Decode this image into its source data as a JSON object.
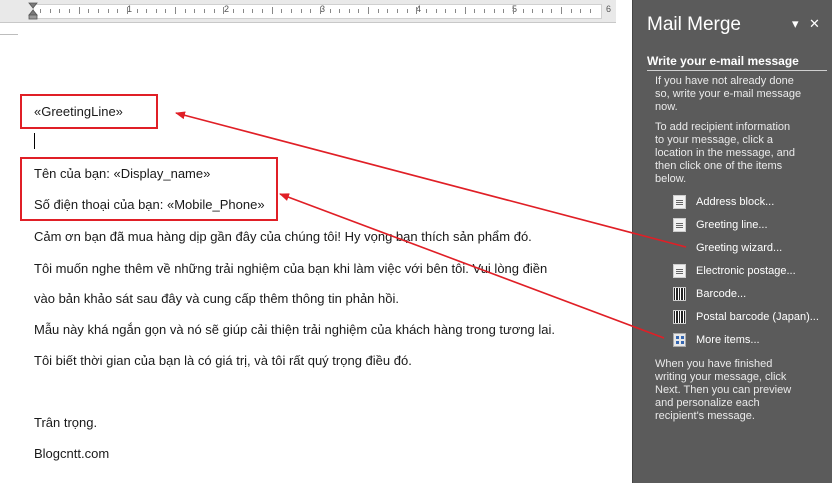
{
  "ruler": {
    "marks": [
      "1",
      "2",
      "3",
      "4",
      "5",
      "6"
    ]
  },
  "document": {
    "fields": {
      "greeting": "«GreetingLine»",
      "name_line": "Tên của bạn: «Display_name»",
      "phone_line": "Số điện thoại của bạn: «Mobile_Phone»"
    },
    "paragraphs": [
      "Cảm ơn bạn đã mua hàng dịp gần đây của chúng tôi! Hy vọng bạn thích sản phẩm đó.",
      "Tôi muốn nghe thêm về những trải nghiệm của bạn khi làm việc với bên tôi. Vui lòng điền",
      "vào bản khảo sát sau đây và cung cấp thêm thông tin phản hồi.",
      "Mẫu này khá ngắn gọn và nó sẽ giúp cải thiện trải nghiệm của khách hàng trong tương lai.",
      "Tôi biết thời gian của bạn là có giá trị, và tôi rất quý trọng điều đó."
    ],
    "closing": "Trân trọng.",
    "signature": "Blogcntt.com"
  },
  "pane": {
    "title": "Mail Merge",
    "dropdown_glyph": "▾",
    "close_glyph": "✕",
    "step_heading": "Write your e-mail message",
    "intro_text": [
      "If you have not already done",
      "so, write your e-mail message",
      "now."
    ],
    "instructions_text": [
      "To add recipient information",
      "to your message, click a",
      "location in the message, and",
      "then click one of the items",
      "below."
    ],
    "items": [
      {
        "label": "Address block...",
        "icon": "document-icon"
      },
      {
        "label": "Greeting line...",
        "icon": "document-icon"
      },
      {
        "label": "Greeting wizard...",
        "icon": "none"
      },
      {
        "label": "Electronic postage...",
        "icon": "postage-icon"
      },
      {
        "label": "Barcode...",
        "icon": "barcode-icon"
      },
      {
        "label": "Postal barcode (Japan)...",
        "icon": "barcode-icon"
      },
      {
        "label": "More items...",
        "icon": "grid-icon"
      }
    ],
    "finish_text": [
      "When you have finished",
      "writing your message, click",
      "Next. Then you can preview",
      "and personalize each",
      "recipient's message."
    ]
  },
  "colors": {
    "annotation_red": "#e01f26",
    "pane_background": "#5b5b5b",
    "ruler_background": "#e9e9e9"
  }
}
